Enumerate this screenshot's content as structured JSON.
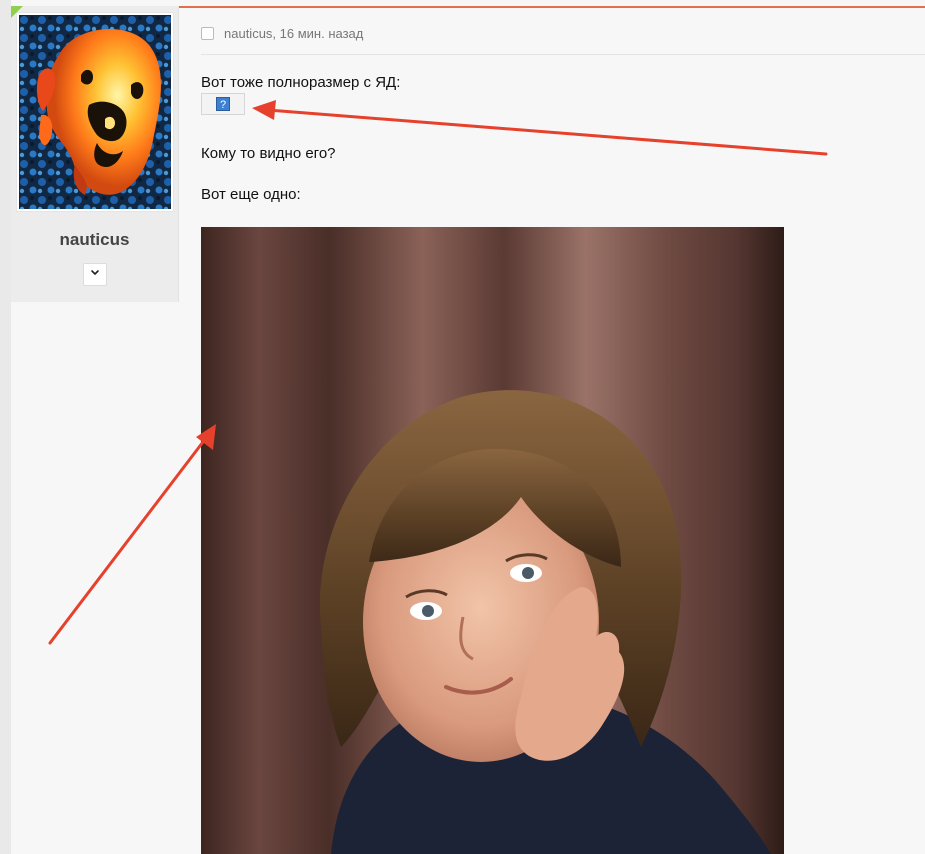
{
  "author": {
    "name": "nauticus",
    "menu_icon": "chevron-down-icon",
    "menu_glyph": "⌄"
  },
  "post": {
    "meta": "nauticus, 16 мин. назад",
    "line1": "Вот тоже полноразмер с ЯД:",
    "broken_image_glyph": "?",
    "line2": "Кому то видно его?",
    "line3": "Вот еще одно:"
  },
  "colors": {
    "accent_line": "#e3704d",
    "arrow": "#e6412c",
    "new_marker": "#8fd14f"
  }
}
